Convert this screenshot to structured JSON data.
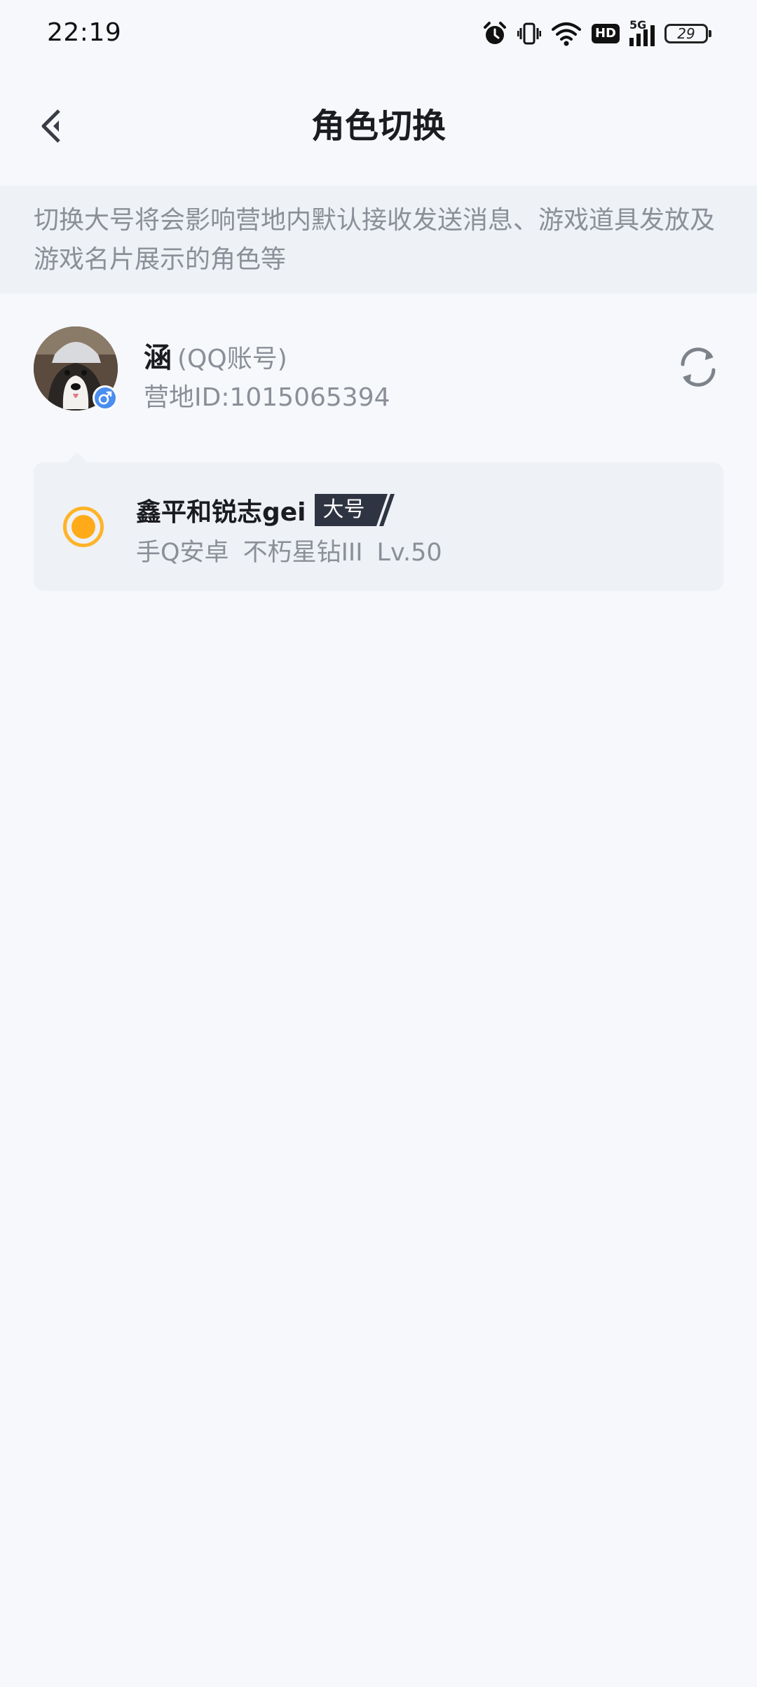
{
  "status_bar": {
    "time": "22:19",
    "network": "5G",
    "hd_label": "HD",
    "battery": "29"
  },
  "nav": {
    "title": "角色切换"
  },
  "notice": {
    "text": "切换大号将会影响营地内默认接收发送消息、游戏道具发放及游戏名片展示的角色等"
  },
  "account": {
    "name": "涵",
    "type": "(QQ账号)",
    "id": "营地ID:1015065394",
    "gender_icon": "male-icon"
  },
  "role": {
    "name": "鑫平和锐志gei",
    "tag": "大号",
    "platform": "手Q安卓",
    "rank": "不朽星钻III",
    "level": "Lv.50",
    "selected": true
  },
  "colors": {
    "accent": "#ffab19",
    "background": "#f6f8fb",
    "muted_text": "#8a8f98",
    "tag_bg": "#2f3442"
  }
}
